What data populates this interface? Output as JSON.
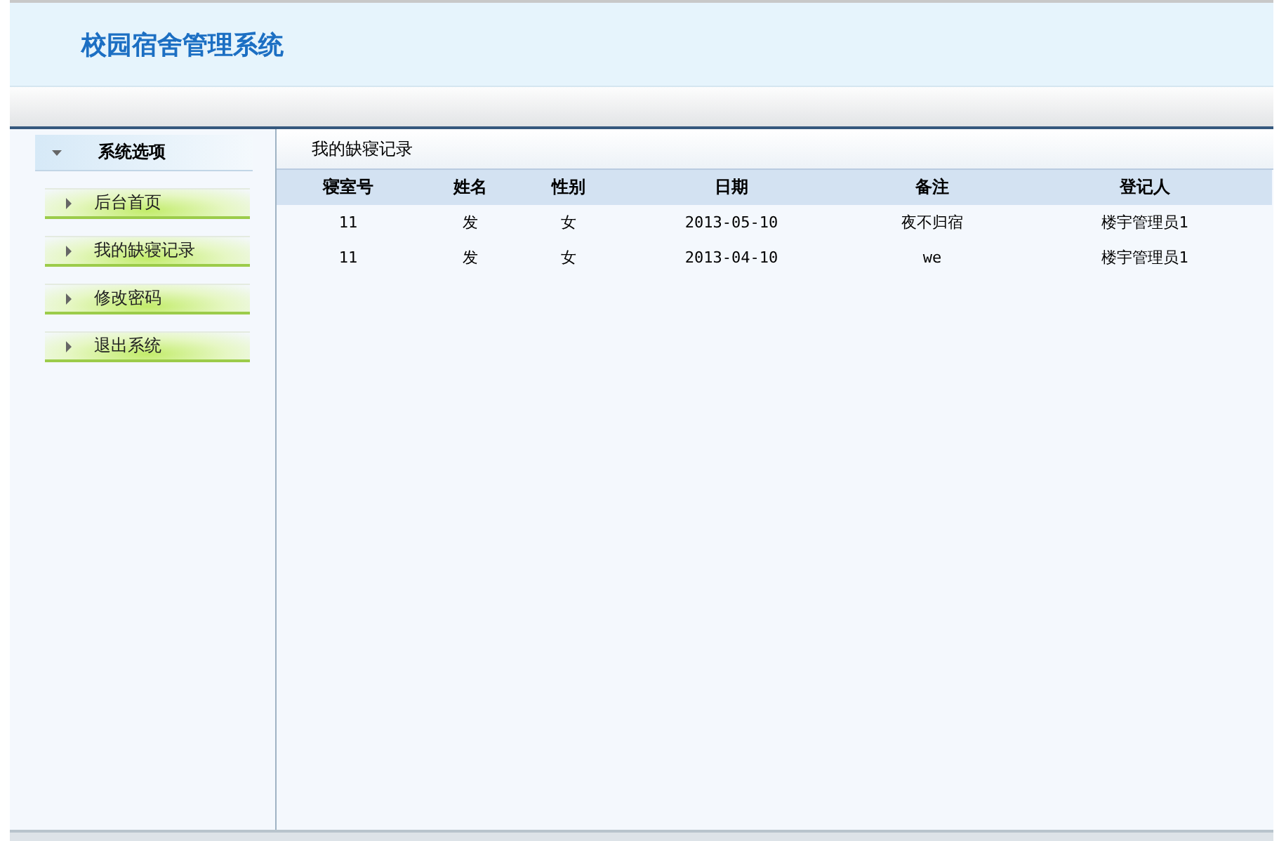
{
  "header": {
    "title": "校园宿舍管理系统"
  },
  "sidebar": {
    "heading": "系统选项",
    "items": [
      {
        "label": "后台首页"
      },
      {
        "label": "我的缺寝记录"
      },
      {
        "label": "修改密码"
      },
      {
        "label": "退出系统"
      }
    ]
  },
  "content": {
    "title": "我的缺寝记录",
    "table": {
      "columns": [
        "寝室号",
        "姓名",
        "性别",
        "日期",
        "备注",
        "登记人"
      ],
      "rows": [
        [
          "11",
          "发",
          "女",
          "2013-05-10",
          "夜不归宿",
          "楼宇管理员1"
        ],
        [
          "11",
          "发",
          "女",
          "2013-04-10",
          "we",
          "楼宇管理员1"
        ]
      ]
    }
  }
}
